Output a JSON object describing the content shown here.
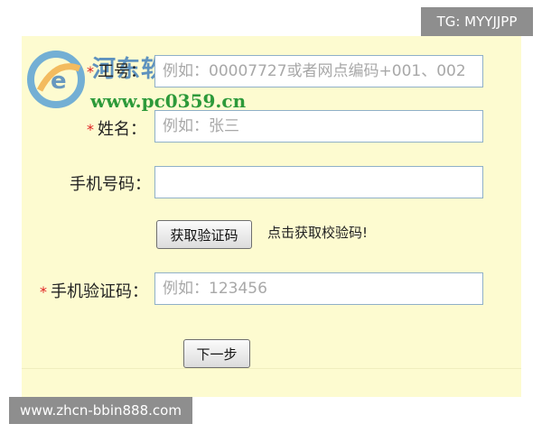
{
  "tags": {
    "top_right": "TG: MYYJJPP",
    "bottom_left": "www.zhcn-bbin888.com"
  },
  "watermark": {
    "title": "河东软件园",
    "url": "www.pc0359.cn"
  },
  "form": {
    "required_mark": "*",
    "employee_id": {
      "label": "工号：",
      "placeholder": "例如：00007727或者网点编码+001、002"
    },
    "name": {
      "label": "姓名：",
      "placeholder": "例如：张三"
    },
    "phone": {
      "label": "手机号码：",
      "value": ""
    },
    "get_code_button": "获取验证码",
    "get_code_hint": "点击获取校验码!",
    "sms_code": {
      "label": "手机验证码：",
      "placeholder": "例如：123456"
    },
    "next_button": "下一步"
  }
}
